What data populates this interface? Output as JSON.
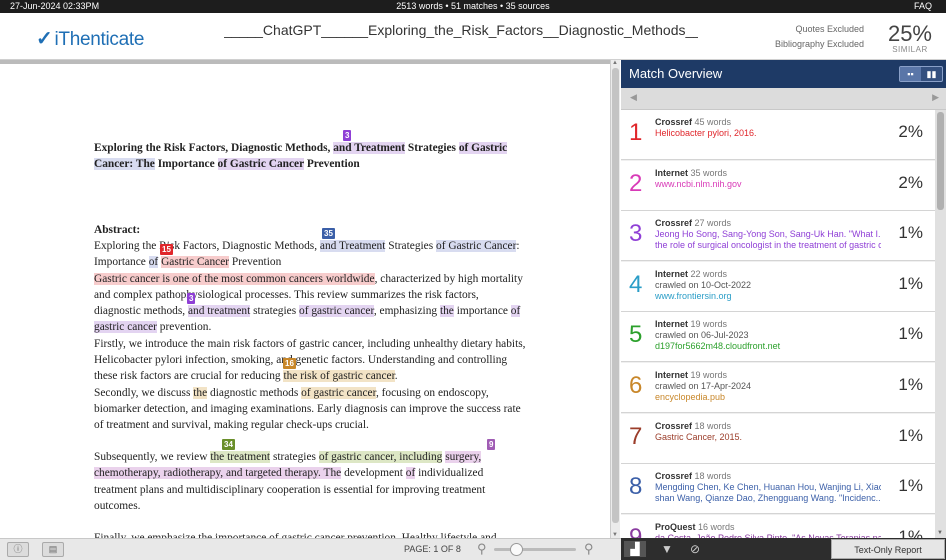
{
  "topbar": {
    "datetime": "27-Jun-2024 02:33PM",
    "info": "2513 words • 51 matches • 35 sources",
    "faq": "FAQ"
  },
  "header": {
    "logo": "iThenticate",
    "doc_title": "_____ChatGPT______Exploring_the_Risk_Factors__Diagnostic_Methods__and_",
    "quotes": "Quotes Excluded",
    "bibliography": "Bibliography Excluded",
    "similarity": "25%",
    "similar_label": "SIMILAR"
  },
  "document": {
    "title_lines": [
      [
        {
          "t": "Exploring the Risk Factors, Diagnostic Methods, "
        },
        {
          "t": "and Treatment",
          "h": "purple"
        },
        {
          "t": " Strategies "
        },
        {
          "t": "of Gastric",
          "h": "purple"
        }
      ],
      [
        {
          "t": "Cancer: The",
          "h": "blue"
        },
        {
          "t": " Importance "
        },
        {
          "t": "of Gastric Cancer",
          "h": "purple"
        },
        {
          "t": " Prevention"
        }
      ]
    ],
    "abstract_label": "Abstract:",
    "abstract_lines": [
      [
        {
          "t": "Exploring the Risk Factors, Diagnostic Methods, "
        },
        {
          "t": "and Treatment",
          "h": "blue"
        },
        {
          "t": " Strategies "
        },
        {
          "t": "of Gastric Cancer",
          "h": "blue"
        },
        {
          "t": ":"
        }
      ],
      [
        {
          "t": "Importance "
        },
        {
          "t": "of",
          "h": "blue"
        },
        {
          "t": " "
        },
        {
          "t": "Gastric Cancer",
          "h": "red"
        },
        {
          "t": " Prevention"
        }
      ],
      [
        {
          "t": "Gastric cancer is one of the most common cancers worldwide",
          "h": "red"
        },
        {
          "t": ", characterized by high mortality"
        }
      ],
      [
        {
          "t": "and complex pathophysiological processes. This review summarizes the risk factors,"
        }
      ],
      [
        {
          "t": "diagnostic methods, "
        },
        {
          "t": "and treatment",
          "h": "purple"
        },
        {
          "t": " strategies "
        },
        {
          "t": "of gastric cancer",
          "h": "purple"
        },
        {
          "t": ", emphasizing "
        },
        {
          "t": "the",
          "h": "purple"
        },
        {
          "t": " importance "
        },
        {
          "t": "of",
          "h": "purple"
        }
      ],
      [
        {
          "t": "gastric cancer",
          "h": "purple"
        },
        {
          "t": " prevention."
        }
      ],
      [
        {
          "t": "Firstly, we introduce the main risk factors of gastric cancer, including unhealthy dietary habits,"
        }
      ],
      [
        {
          "t": "Helicobacter pylori infection, smoking, and genetic factors. Understanding and controlling"
        }
      ],
      [
        {
          "t": "these risk factors are crucial for reducing "
        },
        {
          "t": "the risk of gastric cancer",
          "h": "tan"
        },
        {
          "t": "."
        }
      ],
      [
        {
          "t": "Secondly, we discuss "
        },
        {
          "t": "the",
          "h": "tan"
        },
        {
          "t": " diagnostic methods "
        },
        {
          "t": "of gastric cancer",
          "h": "tan"
        },
        {
          "t": ", focusing on endoscopy,"
        }
      ],
      [
        {
          "t": "biomarker detection, and imaging examinations. Early diagnosis can improve the success rate"
        }
      ],
      [
        {
          "t": "of treatment and survival, making regular check-ups crucial."
        }
      ]
    ],
    "para3_lines": [
      [
        {
          "t": "Subsequently, we review "
        },
        {
          "t": "the treatment",
          "h": "green"
        },
        {
          "t": " strategies "
        },
        {
          "t": "of gastric cancer, including",
          "h": "green"
        },
        {
          "t": " "
        },
        {
          "t": "surgery,",
          "h": "pink"
        }
      ],
      [
        {
          "t": "chemotherapy, radiotherapy, and targeted therapy. The",
          "h": "pink"
        },
        {
          "t": " development "
        },
        {
          "t": "of",
          "h": "pink"
        },
        {
          "t": " individualized"
        }
      ],
      [
        {
          "t": "treatment plans and multidisciplinary cooperation is essential for improving treatment"
        }
      ],
      [
        {
          "t": "outcomes."
        }
      ]
    ],
    "partial_line": "Finally, we emphasize the importance of gastric cancer prevention. Healthy lifestyle and",
    "badges": {
      "b3a": "3",
      "b35": "35",
      "b15": "15",
      "b3b": "3",
      "b16": "16",
      "b34": "34",
      "b9": "9"
    }
  },
  "bottom": {
    "page_indicator": "PAGE: 1 OF 8"
  },
  "panel": {
    "title": "Match Overview",
    "text_only": "Text-Only Report",
    "matches": [
      {
        "num": "1",
        "type": "Crossref",
        "words": "45 words",
        "line1": "Helicobacter pylori, 2016.",
        "line2": "",
        "color": "#e0262b",
        "pct": "2%"
      },
      {
        "num": "2",
        "type": "Internet",
        "words": "35 words",
        "line1": "www.ncbi.nlm.nih.gov",
        "line2": "",
        "color": "#d83ab7",
        "pct": "2%"
      },
      {
        "num": "3",
        "type": "Crossref",
        "words": "27 words",
        "line1": "Jeong Ho Song, Sang-Yong Son, Sang-Uk Han. \"What I...",
        "line2": "the role of surgical oncologist in the treatment of gastric c",
        "color": "#8f3fd6",
        "pct": "1%"
      },
      {
        "num": "4",
        "type": "Internet",
        "words": "22 words",
        "sub": "crawled on 10-Oct-2022",
        "line1": "www.frontiersin.org",
        "line2": "",
        "color": "#2a9dc7",
        "pct": "1%"
      },
      {
        "num": "5",
        "type": "Internet",
        "words": "19 words",
        "sub": "crawled on 06-Jul-2023",
        "line1": "d197for5662m48.cloudfront.net",
        "line2": "",
        "color": "#2ca02c",
        "pct": "1%"
      },
      {
        "num": "6",
        "type": "Internet",
        "words": "19 words",
        "sub": "crawled on 17-Apr-2024",
        "line1": "encyclopedia.pub",
        "line2": "",
        "color": "#c8872a",
        "pct": "1%"
      },
      {
        "num": "7",
        "type": "Crossref",
        "words": "18 words",
        "line1": "Gastric Cancer, 2015.",
        "line2": "",
        "color": "#9b3d2a",
        "pct": "1%"
      },
      {
        "num": "8",
        "type": "Crossref",
        "words": "18 words",
        "line1": "Mengding Chen, Ke Chen, Huanan Hou, Wanjing Li, Xiao",
        "line2": "shan Wang, Qianze Dao, Zhengguang Wang. \"Incidenc...",
        "color": "#3b5fa8",
        "pct": "1%"
      },
      {
        "num": "9",
        "type": "ProQuest",
        "words": "16 words",
        "line1": "da Costa, João Pedro Silva Pinto. \"As Novas Terapias par...",
        "line2": "",
        "color": "#8a3ba0",
        "pct": "1%"
      }
    ]
  },
  "colors": {
    "header_blue": "#1e3a66",
    "hl_purple": "#e3d4f1",
    "hl_blue": "#d8dcf0",
    "hl_red": "#f7cccc",
    "hl_tan": "#f2e3c6",
    "hl_green": "#dde7c5",
    "hl_pink": "#ead2ec"
  }
}
